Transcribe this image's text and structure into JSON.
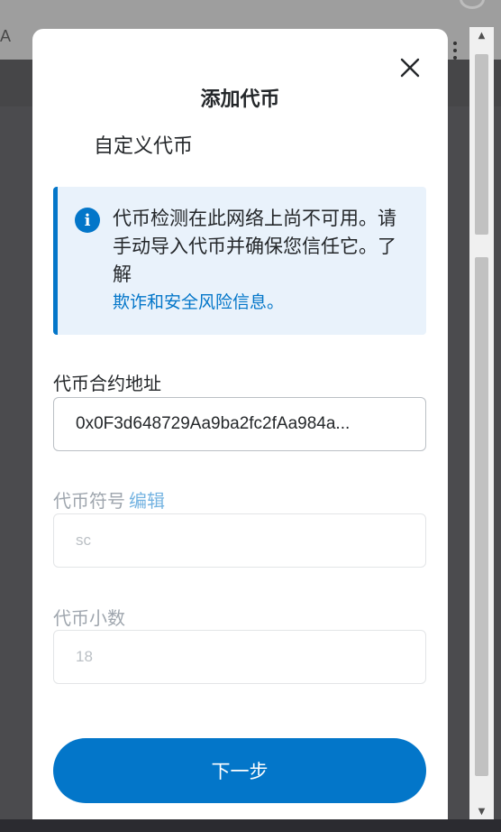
{
  "background": {
    "truncated_letter": "A"
  },
  "modal": {
    "title": "添加代币",
    "section_title": "自定义代币",
    "info": {
      "text": "代币检测在此网络上尚不可用。请手动导入代币并确保您信任它。了解",
      "link": "欺诈和安全风险信息。"
    },
    "fields": {
      "contract_address": {
        "label": "代币合约地址",
        "value": "0x0F3d648729Aa9ba2fc2fAa984a..."
      },
      "symbol": {
        "label": "代币符号",
        "edit_link": "编辑",
        "value": "sc"
      },
      "decimals": {
        "label": "代币小数",
        "value": "18"
      }
    },
    "next_button": "下一步"
  },
  "icons": {
    "close": "close-icon",
    "info": "info-icon",
    "menu": "kebab-menu-icon"
  },
  "colors": {
    "accent": "#0376c9",
    "info_bg": "#e9f2fb",
    "muted": "#9fa6ae"
  }
}
